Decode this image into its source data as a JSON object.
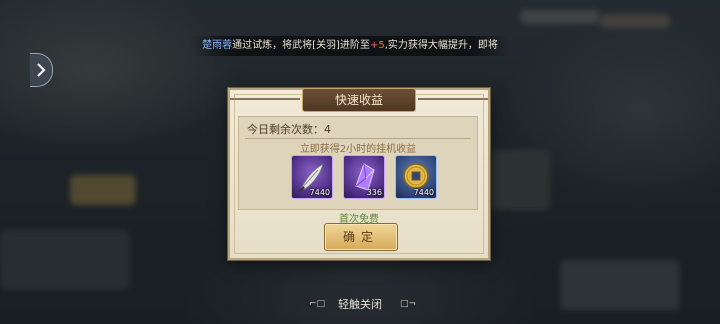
{
  "ticker": {
    "name": "楚雨蓉",
    "part1": "通过试炼，将武将[关羽]进阶至",
    "plus": "+5",
    "part2": ",实力获得大幅提升，即将"
  },
  "dialog": {
    "title": "快速收益",
    "remaining_label": "今日剩余次数：4",
    "hint": "立即获得2小时的挂机收益",
    "rewards": [
      {
        "icon": "quill-feather-icon",
        "quantity": "7440",
        "rarity": "purple"
      },
      {
        "icon": "purple-crystal-icon",
        "quantity": "336",
        "rarity": "purple"
      },
      {
        "icon": "gold-coin-icon",
        "quantity": "7440",
        "rarity": "blue"
      }
    ],
    "free_label": "首次免费",
    "confirm_label": "确定"
  },
  "close_hint": "轻触关闭"
}
